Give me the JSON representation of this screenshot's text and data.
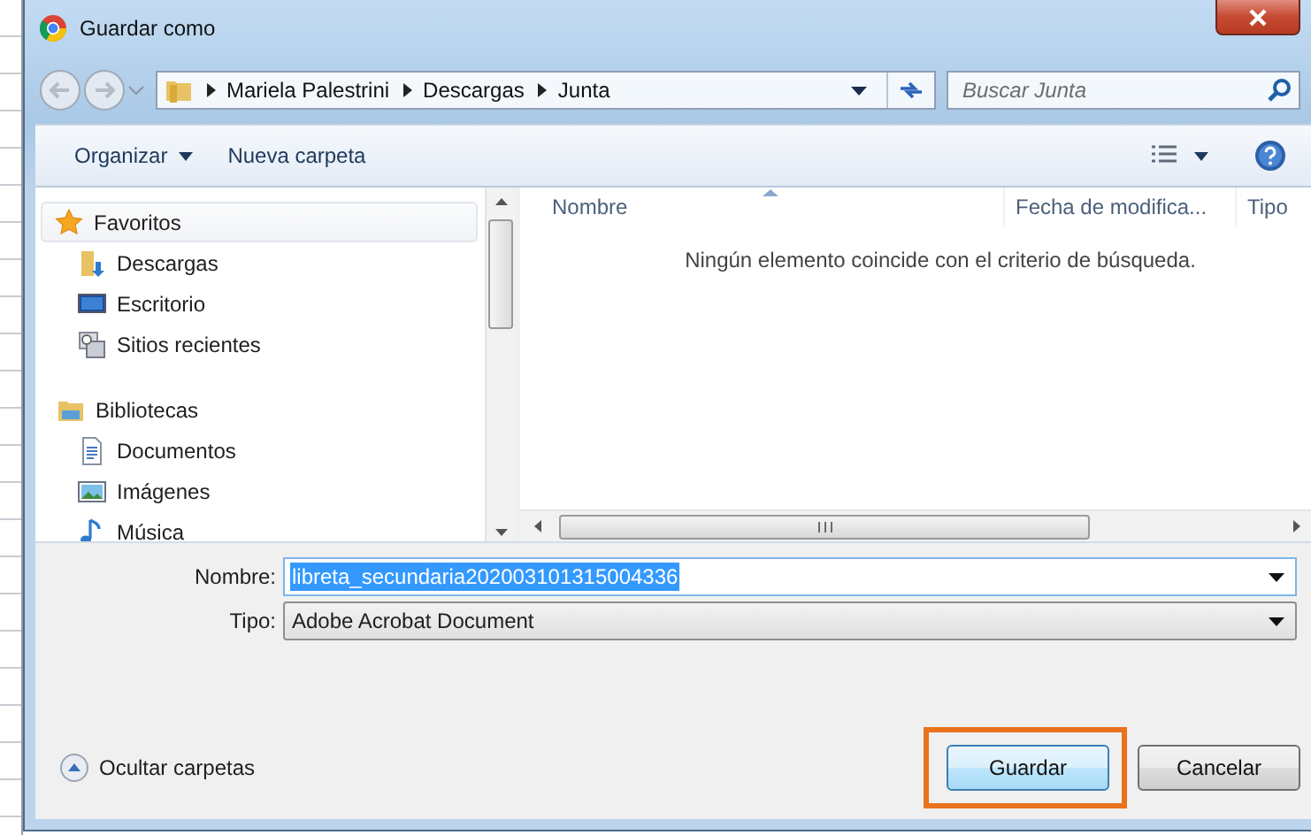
{
  "window": {
    "title": "Guardar como"
  },
  "address_bar": {
    "path": [
      "Mariela Palestrini",
      "Descargas",
      "Junta"
    ]
  },
  "search": {
    "placeholder": "Buscar Junta"
  },
  "toolbar": [
    {
      "label": "Organizar",
      "kind": "menu"
    },
    {
      "label": "Nueva carpeta",
      "kind": "button"
    }
  ],
  "sidebar": {
    "groups": [
      {
        "label": "Favoritos",
        "selected": true,
        "children": [
          {
            "label": "Descargas",
            "selected": false
          },
          {
            "label": "Escritorio",
            "selected": false
          },
          {
            "label": "Sitios recientes",
            "selected": false
          }
        ]
      },
      {
        "label": "Bibliotecas",
        "selected": false,
        "children": [
          {
            "label": "Documentos",
            "selected": false
          },
          {
            "label": "Imágenes",
            "selected": false
          },
          {
            "label": "Música",
            "selected": false
          }
        ]
      }
    ]
  },
  "file_list": {
    "columns": [
      {
        "label": "Nombre",
        "sorted": true
      },
      {
        "label": "Fecha de modifica...",
        "sorted": false
      },
      {
        "label": "Tipo",
        "sorted": false
      }
    ],
    "empty_message": "Ningún elemento coincide con el criterio de búsqueda."
  },
  "form": {
    "fields": [
      {
        "label": "Nombre:",
        "value": "libreta_secundaria202003101315004336",
        "kind": "combo",
        "text_selected": true
      },
      {
        "label": "Tipo:",
        "value": "Adobe Acrobat Document",
        "kind": "select",
        "text_selected": false
      }
    ]
  },
  "hide_folders": {
    "label": "Ocultar carpetas"
  },
  "buttons": [
    {
      "label": "Guardar",
      "default": true,
      "highlighted": true
    },
    {
      "label": "Cancelar",
      "default": false,
      "highlighted": false
    }
  ]
}
